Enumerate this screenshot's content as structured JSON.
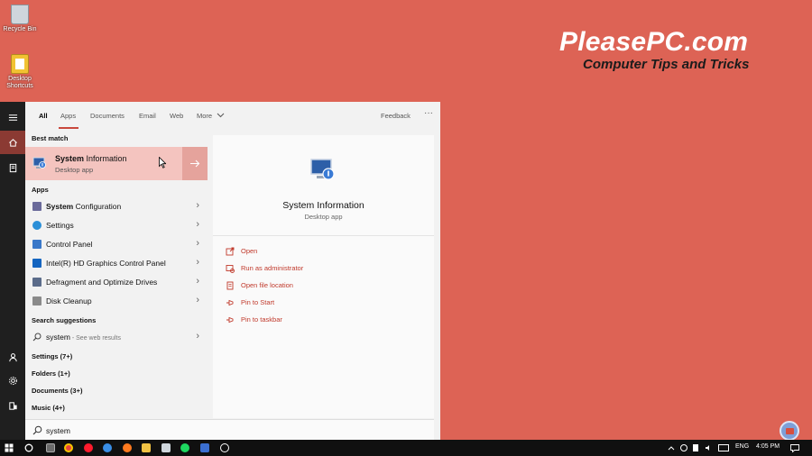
{
  "desktop": {
    "icons": [
      {
        "label": "Recycle Bin"
      },
      {
        "label": "Desktop Shortcuts"
      }
    ],
    "brand": {
      "title": "PleasePC.com",
      "tagline": "Computer Tips and Tricks"
    }
  },
  "start_menu": {
    "tabs": [
      {
        "label": "All",
        "active": true
      },
      {
        "label": "Apps"
      },
      {
        "label": "Documents"
      },
      {
        "label": "Email"
      },
      {
        "label": "Web"
      },
      {
        "label": "More"
      }
    ],
    "feedback_label": "Feedback",
    "more_options": "···",
    "best_match_heading": "Best match",
    "best_match": {
      "title_bold": "System",
      "title_rest": " Information",
      "subtitle": "Desktop app"
    },
    "apps_heading": "Apps",
    "apps": [
      {
        "bold": "System",
        "rest": " Configuration",
        "color": "#6a6a9a"
      },
      {
        "bold": "",
        "rest": "Settings",
        "color": "#2a8fd8"
      },
      {
        "bold": "",
        "rest": "Control Panel",
        "color": "#3a78c9"
      },
      {
        "bold": "",
        "rest": "Intel(R) HD Graphics Control Panel",
        "color": "#1565c0"
      },
      {
        "bold": "",
        "rest": "Defragment and Optimize Drives",
        "color": "#5b6c8a"
      },
      {
        "bold": "",
        "rest": "Disk Cleanup",
        "color": "#8a8a8a"
      }
    ],
    "suggestions_heading": "Search suggestions",
    "suggestion": {
      "query": "system",
      "hint": " - See web results"
    },
    "groups": [
      "Settings (7+)",
      "Folders (1+)",
      "Documents (3+)",
      "Music (4+)"
    ],
    "search_value": "system",
    "preview": {
      "title": "System Information",
      "subtitle": "Desktop app",
      "actions": [
        "Open",
        "Run as administrator",
        "Open file location",
        "Pin to Start",
        "Pin to taskbar"
      ]
    }
  },
  "taskbar": {
    "language": "ENG",
    "time": "4:05 PM"
  },
  "colors": {
    "desktop": "#dd6355",
    "accent": "#c9483d",
    "highlight": "#f4c4bf"
  }
}
